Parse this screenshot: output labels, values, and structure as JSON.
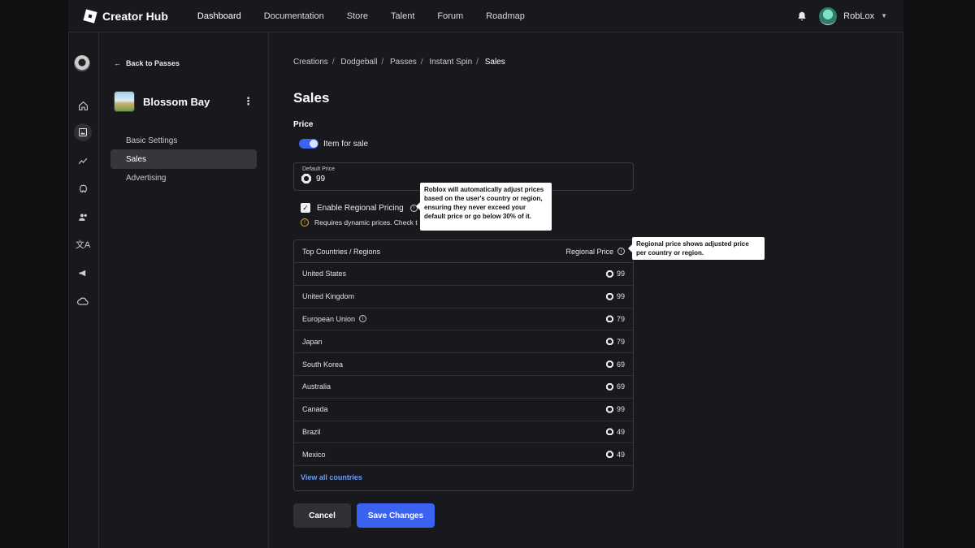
{
  "brand": "Creator Hub",
  "nav": [
    "Dashboard",
    "Documentation",
    "Store",
    "Talent",
    "Forum",
    "Roadmap"
  ],
  "user": {
    "name": "RobLox"
  },
  "sidebar": {
    "back_label": "Back to Passes",
    "experience_name": "Blossom Bay",
    "items": [
      "Basic Settings",
      "Sales",
      "Advertising"
    ]
  },
  "breadcrumbs": [
    "Creations",
    "Dodgeball",
    "Passes",
    "Instant Spin",
    "Sales"
  ],
  "page_title": "Sales",
  "price_section": {
    "label": "Price",
    "toggle_label": "Item for sale",
    "default_price_label": "Default Price",
    "default_price": "99"
  },
  "regional": {
    "checkbox_label": "Enable Regional Pricing",
    "warning": "Requires dynamic prices. Check t",
    "tooltip": "Roblox will automatically adjust prices based on the user's country or region, ensuring they never exceed your default price or go below 30% of it."
  },
  "table": {
    "col_country": "Top Countries / Regions",
    "col_price": "Regional Price",
    "tooltip": "Regional price shows adjusted price per country or region.",
    "rows": [
      {
        "name": "United States",
        "price": "99"
      },
      {
        "name": "United Kingdom",
        "price": "99"
      },
      {
        "name": "European Union",
        "price": "79"
      },
      {
        "name": "Japan",
        "price": "79"
      },
      {
        "name": "South Korea",
        "price": "69"
      },
      {
        "name": "Australia",
        "price": "69"
      },
      {
        "name": "Canada",
        "price": "99"
      },
      {
        "name": "Brazil",
        "price": "49"
      },
      {
        "name": "Mexico",
        "price": "49"
      }
    ],
    "view_all": "View all countries"
  },
  "buttons": {
    "cancel": "Cancel",
    "save": "Save Changes"
  },
  "colors": {
    "accent": "#3b62f0",
    "link": "#6e9cf5",
    "warning": "#f0b429"
  }
}
